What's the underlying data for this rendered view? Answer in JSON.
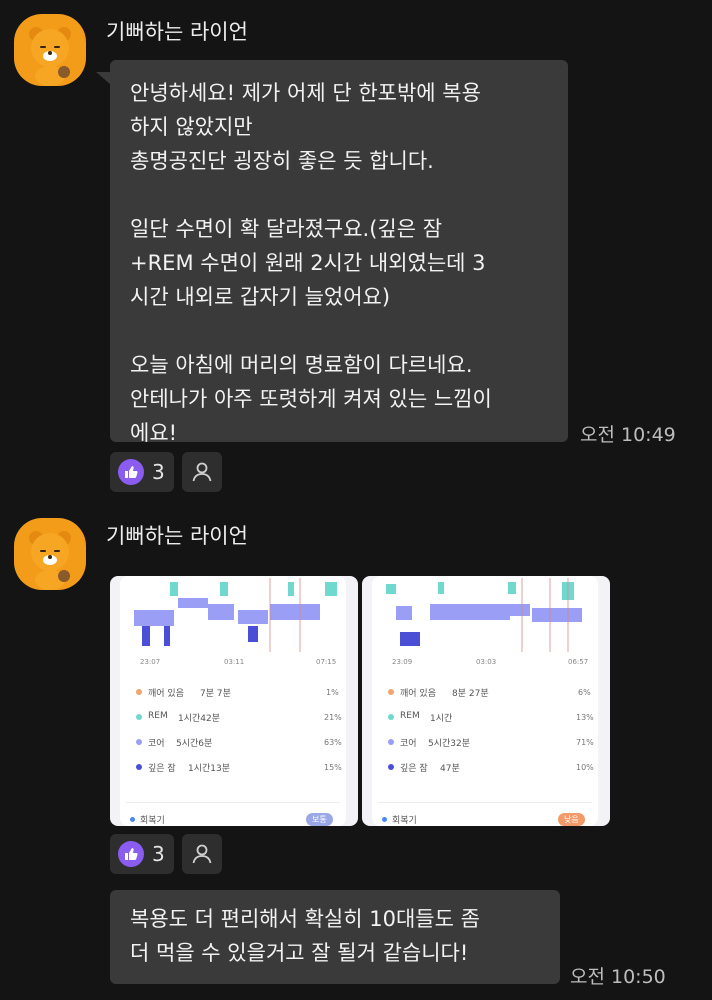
{
  "colors": {
    "background": "#141414",
    "bubble": "#3a3a3a",
    "reaction_like": "#8a5cf0",
    "avatar": "#f39c1a"
  },
  "messages": [
    {
      "sender": "기뻐하는 라이언",
      "text": "안녕하세요! 제가 어제 단 한포밖에 복용\n하지 않았지만\n총명공진단 굉장히 좋은 듯 합니다.\n\n일단 수면이 확 달라졌구요.(깊은 잠\n+REM 수면이 원래 2시간 내외였는데 3\n시간 내외로 갑자기 늘었어요)\n\n오늘 아침에 머리의 명료함이 다르네요.\n안테나가 아주 또렷하게 켜져 있는 느낌이\n에요!",
      "time": "오전 10:49",
      "reaction_count": "3"
    },
    {
      "sender": "기뻐하는 라이언",
      "reaction_count": "3",
      "screenshots": [
        {
          "times": [
            "23:07",
            "03:11",
            "07:15"
          ],
          "rows": [
            {
              "label": "깨어 있음",
              "value": "7분 7분",
              "pct": "1%",
              "color": "#f3a36c"
            },
            {
              "label": "REM",
              "value": "1시간42분",
              "pct": "21%",
              "color": "#6fd9d0"
            },
            {
              "label": "코어",
              "value": "5시간6분",
              "pct": "63%",
              "color": "#9a9ef5"
            },
            {
              "label": "깊은 잠",
              "value": "1시간13분",
              "pct": "15%",
              "color": "#4a4fd6"
            }
          ],
          "footer": "회복기",
          "badge": "보통",
          "badge_color": "#9aa8e8"
        },
        {
          "times": [
            "23:09",
            "03:03",
            "06:57"
          ],
          "rows": [
            {
              "label": "깨어 있음",
              "value": "8분 27분",
              "pct": "6%",
              "color": "#f3a36c"
            },
            {
              "label": "REM",
              "value": "1시간",
              "pct": "13%",
              "color": "#6fd9d0"
            },
            {
              "label": "코어",
              "value": "5시간32분",
              "pct": "71%",
              "color": "#9a9ef5"
            },
            {
              "label": "깊은 잠",
              "value": "47분",
              "pct": "10%",
              "color": "#4a4fd6"
            }
          ],
          "footer": "회복기",
          "badge": "낮음",
          "badge_color": "#f39a6a"
        }
      ]
    },
    {
      "text": "복용도 더 편리해서 확실히 10대들도 좀\n더 먹을 수 있을거고 잘 될거 같습니다!",
      "time": "오전 10:50"
    }
  ]
}
